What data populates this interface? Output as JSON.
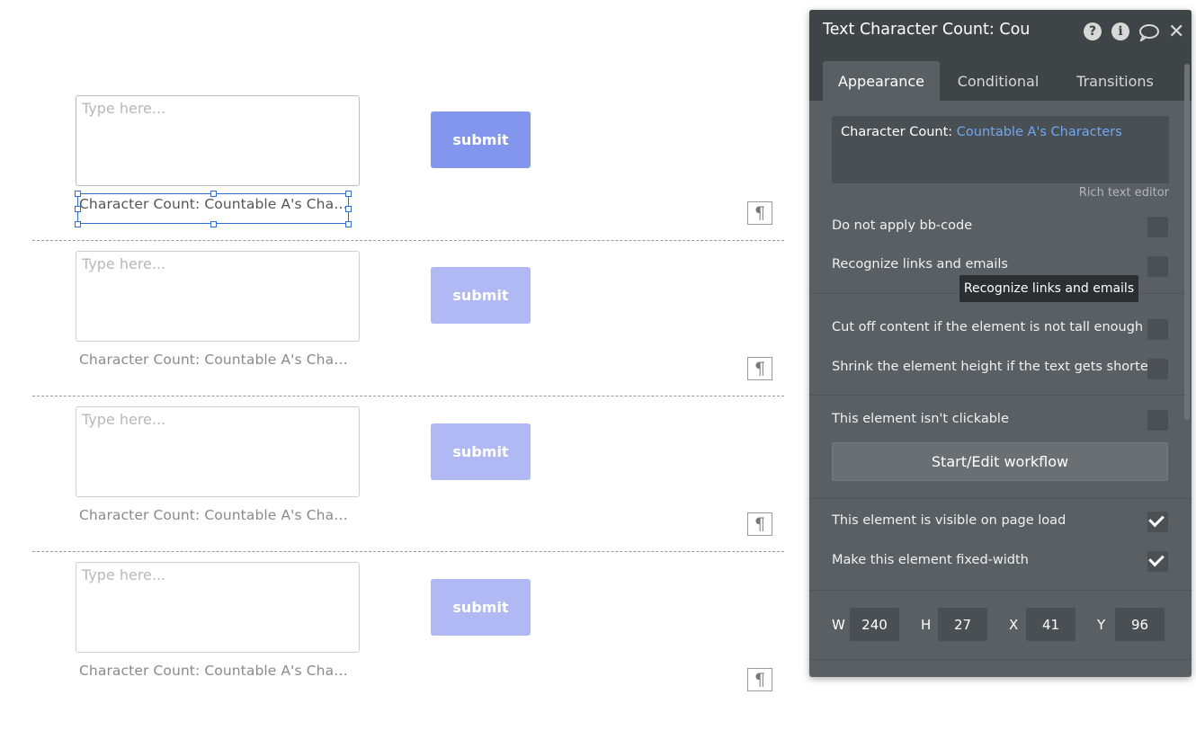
{
  "canvas": {
    "rows": [
      {
        "placeholder": "Type here...",
        "submit_label": "submit",
        "char_count_text": "Character Count: Countable A's Characters",
        "pilcrow": "¶"
      },
      {
        "placeholder": "Type here...",
        "submit_label": "submit",
        "char_count_text": "Character Count: Countable A's Characters",
        "pilcrow": "¶"
      },
      {
        "placeholder": "Type here...",
        "submit_label": "submit",
        "char_count_text": "Character Count: Countable A's Characters",
        "pilcrow": "¶"
      },
      {
        "placeholder": "Type here...",
        "submit_label": "submit",
        "char_count_text": "Character Count: Countable A's Characters",
        "pilcrow": "¶"
      }
    ]
  },
  "panel": {
    "title": "Text Character Count: Cou",
    "icons": {
      "help": "?",
      "info": "i",
      "close": "✕"
    },
    "tabs": [
      {
        "label": "Appearance",
        "active": true
      },
      {
        "label": "Conditional",
        "active": false
      },
      {
        "label": "Transitions",
        "active": false
      }
    ],
    "rich_text": {
      "prefix": "Character Count: ",
      "dynamic": "Countable A's Characters",
      "editor_link": "Rich text editor"
    },
    "options": {
      "no_bbcode": "Do not apply bb-code",
      "recognize_links": "Recognize links and emails",
      "cut_off": "Cut off content if the element is not tall enough",
      "shrink": "Shrink the element height if the text gets shorter",
      "not_clickable": "This element isn't clickable",
      "visible": "This element is visible on page load",
      "fixed_width": "Make this element fixed-width"
    },
    "option_states": {
      "no_bbcode": false,
      "recognize_links": false,
      "cut_off": false,
      "shrink": false,
      "not_clickable": false,
      "visible": true,
      "fixed_width": true
    },
    "tooltip": "Recognize links and emails",
    "workflow_button": "Start/Edit workflow",
    "dimensions": {
      "w_label": "W",
      "w": "240",
      "h_label": "H",
      "h": "27",
      "x_label": "X",
      "x": "41",
      "y_label": "Y",
      "y": "96"
    }
  },
  "colors": {
    "submit_active": "#8396ee",
    "submit_inactive": "#b0b9f3",
    "selection": "#2f6fd0",
    "panel_bg": "#5a5f63",
    "panel_header": "#3f4447",
    "dynamic_text": "#6fa7f2"
  }
}
